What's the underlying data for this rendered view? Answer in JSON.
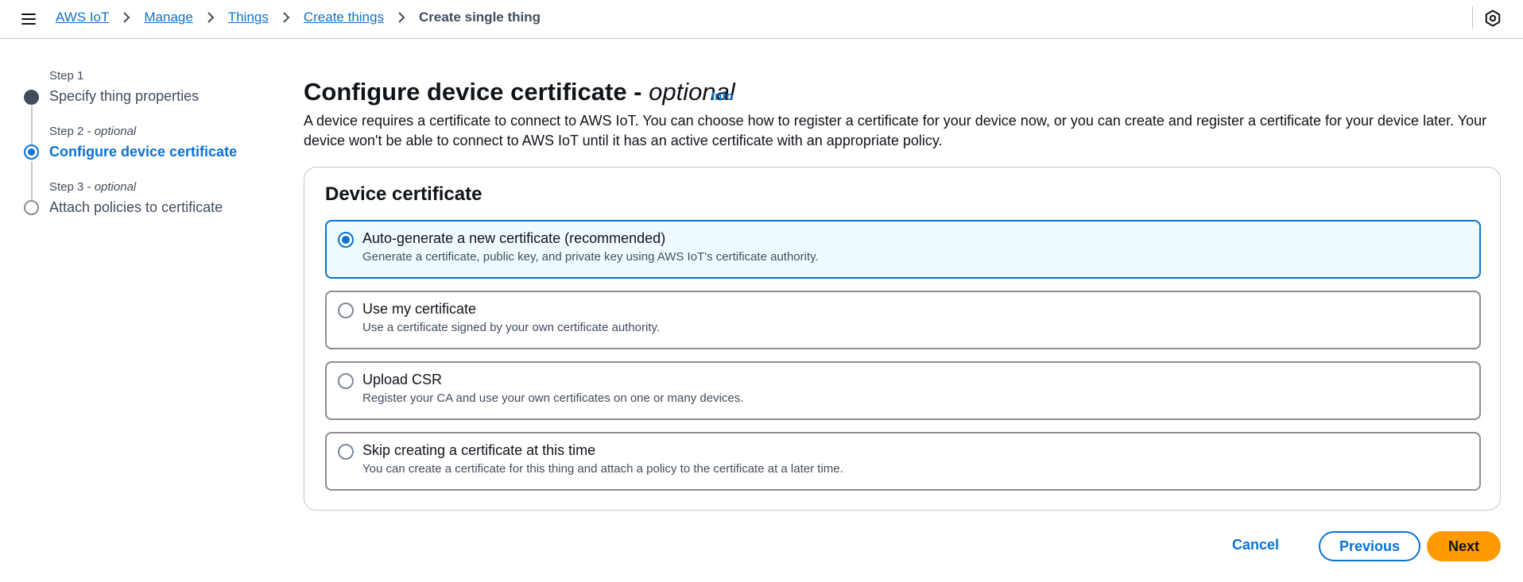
{
  "topbar": {
    "menu_icon": "hamburger-menu-icon",
    "breadcrumbs": [
      "AWS IoT",
      "Manage",
      "Things",
      "Create things"
    ],
    "current": "Create single thing",
    "right_icon": "settings-hexagon-icon"
  },
  "steps": [
    {
      "caption": "Step 1",
      "optional": "",
      "title": "Specify thing properties",
      "state": "completed"
    },
    {
      "caption": "Step 2 - ",
      "optional": "optional",
      "title": "Configure device certificate",
      "state": "active"
    },
    {
      "caption": "Step 3 - ",
      "optional": "optional",
      "title": "Attach policies to certificate",
      "state": "pending"
    }
  ],
  "main": {
    "title": "Configure device certificate - ",
    "title_optional": "optional",
    "info_link": "Info",
    "description": "A device requires a certificate to connect to AWS IoT. You can choose how to register a certificate for your device now, or you can create and register a certificate for your device later. Your device won't be able to connect to AWS IoT until it has an active certificate with an appropriate policy."
  },
  "panel": {
    "title": "Device certificate",
    "options": [
      {
        "label": "Auto-generate a new certificate (recommended)",
        "description": "Generate a certificate, public key, and private key using AWS IoT's certificate authority.",
        "selected": true
      },
      {
        "label": "Use my certificate",
        "description": "Use a certificate signed by your own certificate authority.",
        "selected": false
      },
      {
        "label": "Upload CSR",
        "description": "Register your CA and use your own certificates on one or many devices.",
        "selected": false
      },
      {
        "label": "Skip creating a certificate at this time",
        "description": "You can create a certificate for this thing and attach a policy to the certificate at a later time.",
        "selected": false
      }
    ]
  },
  "footer": {
    "cancel": "Cancel",
    "previous": "Previous",
    "next": "Next"
  },
  "colors": {
    "link": "#0972d3",
    "primary_button": "#ff9900",
    "selected_bg": "#f0fbff",
    "completed_dot": "#414d5c"
  }
}
